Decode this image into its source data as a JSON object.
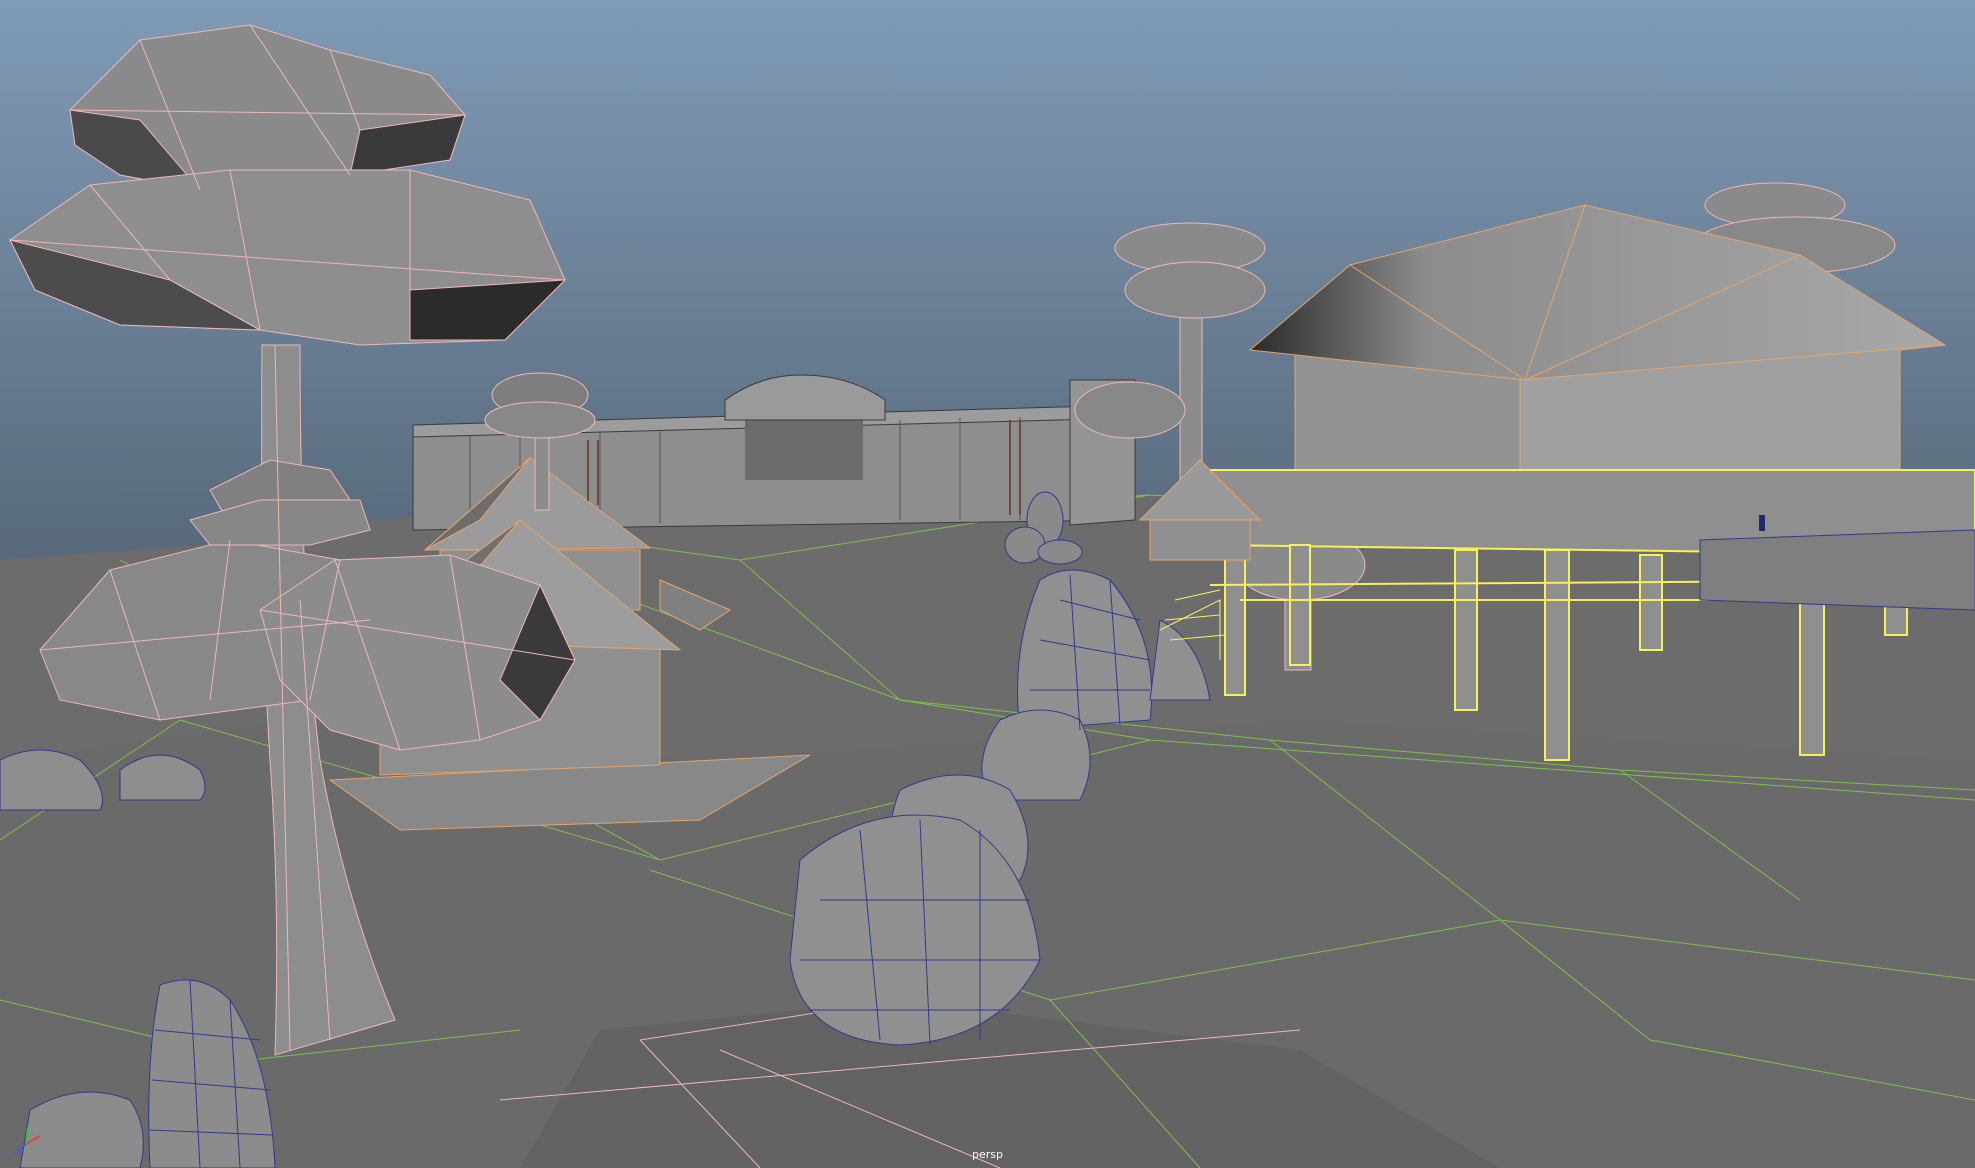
{
  "viewport": {
    "camera_name": "persp",
    "colors": {
      "sky_top": "#7f9bb6",
      "sky_bottom": "#5b6d84",
      "ground": "#6e6e6e",
      "ground_grid": "#7fc04a",
      "mesh_fill": "#8f8f8f",
      "mesh_dark": "#2e2e2e",
      "wire_tree": "#f0b6b6",
      "wire_rock": "#2f3a8f",
      "wire_building": "#e6a36a",
      "wire_selected": "#f6f05a",
      "axis_x": "#e04040",
      "axis_y": "#40c040",
      "axis_z": "#4060e0"
    },
    "objects": [
      {
        "name": "mushroom-tree",
        "count": 6
      },
      {
        "name": "hut",
        "count": 3
      },
      {
        "name": "rock-cluster",
        "count": 6
      },
      {
        "name": "wall-gate",
        "count": 1
      },
      {
        "name": "stilt-house",
        "count": 1,
        "selected": true
      }
    ],
    "axis_gizmo": [
      "x",
      "y",
      "z"
    ]
  }
}
